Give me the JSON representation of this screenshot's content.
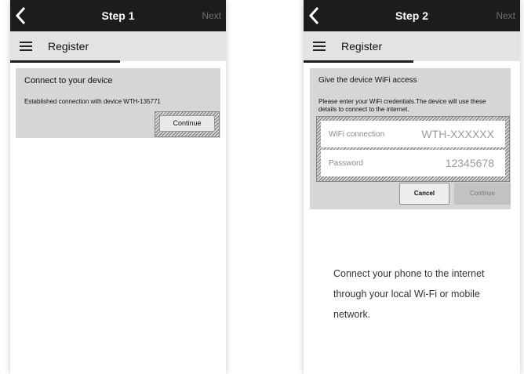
{
  "screen1": {
    "header": {
      "title": "Step 1",
      "next_label": "Next"
    },
    "nav": {
      "title": "Register"
    },
    "card": {
      "title": "Connect to your device",
      "message": "Established connection with device WTH-135771",
      "continue_label": "Continue"
    }
  },
  "screen2": {
    "header": {
      "title": "Step 2",
      "next_label": "Next"
    },
    "nav": {
      "title": "Register"
    },
    "card": {
      "title": "Give the device WiFi access",
      "instructions": "Please enter your WiFi credentials.The device will use these details to connect to the internet.",
      "wifi_label": "WiFi connection",
      "wifi_value": "WTH-XXXXXX",
      "password_label": "Password",
      "password_value": "12345678",
      "cancel_label": "Cancel",
      "continue_label": "Continue"
    },
    "info_text": "Connect your phone to the internet through your local Wi-Fi or mobile network."
  },
  "icons": {
    "back": "chevron-left-icon",
    "menu": "hamburger-menu-icon"
  }
}
